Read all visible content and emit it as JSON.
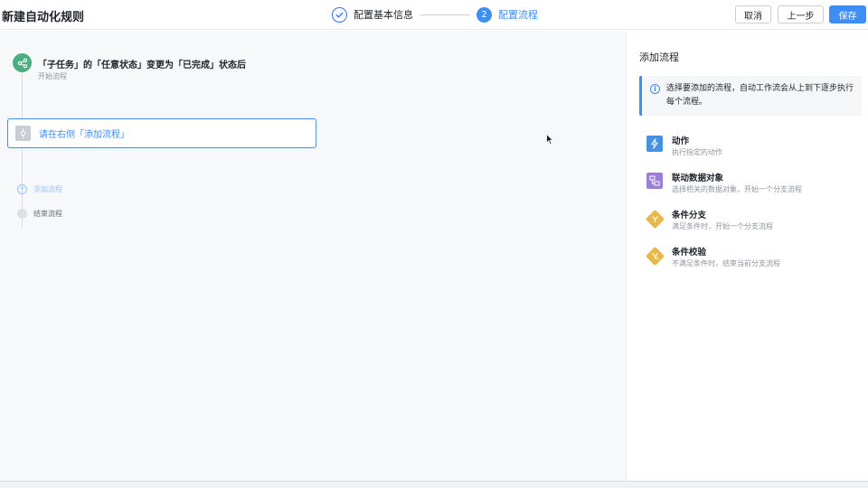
{
  "header": {
    "title": "新建自动化规则",
    "steps": [
      {
        "number": "",
        "label": "配置基本信息",
        "state": "done"
      },
      {
        "number": "2",
        "label": "配置流程",
        "state": "active"
      }
    ],
    "buttons": {
      "cancel": "取消",
      "prev": "上一步",
      "save": "保存"
    }
  },
  "flow": {
    "trigger_title": "「子任务」的「任意状态」变更为「已完成」状态后",
    "trigger_sub": "开始流程",
    "placeholder": "请在右侧「添加流程」",
    "add_label": "添加流程",
    "end_label": "结束流程"
  },
  "panel": {
    "title": "添加流程",
    "info": "选择要添加的流程，自动工作流会从上到下逐步执行每个流程。",
    "options": [
      {
        "title": "动作",
        "desc": "执行指定的动作",
        "icon": "lightning-icon",
        "color": "#4a90e2"
      },
      {
        "title": "联动数据对象",
        "desc": "选择相关的数据对象，开始一个分支流程",
        "icon": "linked-data-icon",
        "color": "#9b7fd6"
      },
      {
        "title": "条件分支",
        "desc": "满足条件时，开始一个分支流程",
        "icon": "branch-icon",
        "color": "#e8b84a"
      },
      {
        "title": "条件校验",
        "desc": "不满足条件时，结束当前分支流程",
        "icon": "condition-check-icon",
        "color": "#e8b84a"
      }
    ]
  },
  "colors": {
    "accent": "#3d8ff5",
    "trigger": "#4caf82"
  }
}
